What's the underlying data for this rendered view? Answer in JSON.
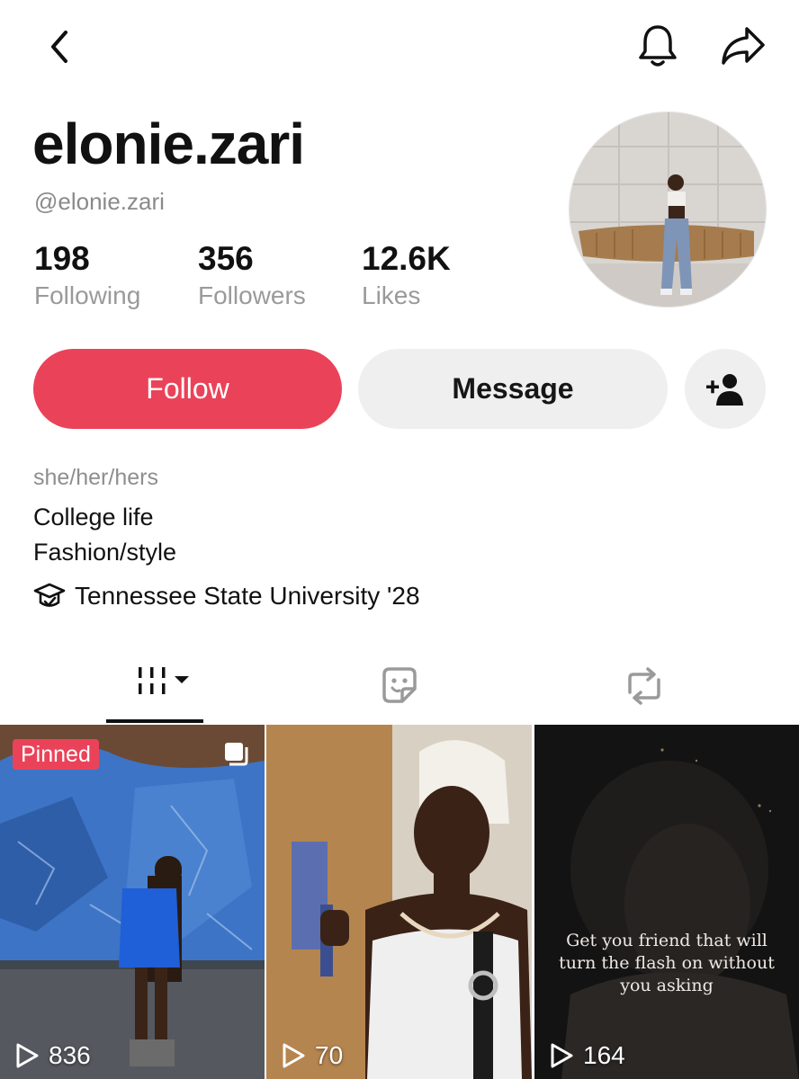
{
  "header": {
    "icons": {
      "back": "chevron-left-icon",
      "notifications": "bell-icon",
      "share": "share-arrow-icon"
    }
  },
  "profile": {
    "display_name": "elonie.zari",
    "handle": "@elonie.zari",
    "stats": {
      "following": {
        "value": "198",
        "label": "Following"
      },
      "followers": {
        "value": "356",
        "label": "Followers"
      },
      "likes": {
        "value": "12.6K",
        "label": "Likes"
      }
    },
    "pronouns": "she/her/hers",
    "bio_lines": [
      "College life",
      "Fashion/style"
    ],
    "school": "Tennessee State University '28"
  },
  "actions": {
    "follow_label": "Follow",
    "message_label": "Message",
    "add_friend_icon": "add-person-icon"
  },
  "tabs": [
    {
      "name": "videos",
      "icon": "grid-bars-icon",
      "active": true
    },
    {
      "name": "stickers",
      "icon": "sticker-icon",
      "active": false
    },
    {
      "name": "reposts",
      "icon": "repost-icon",
      "active": false
    }
  ],
  "videos": [
    {
      "views": "836",
      "pinned_label": "Pinned",
      "multi_photo": true
    },
    {
      "views": "70"
    },
    {
      "views": "164",
      "overlay_text": "Get you friend that will turn the flash on without you asking"
    }
  ],
  "colors": {
    "accent": "#ea4359",
    "secondary_button": "#efefef",
    "muted_text": "#8e8e8e"
  }
}
